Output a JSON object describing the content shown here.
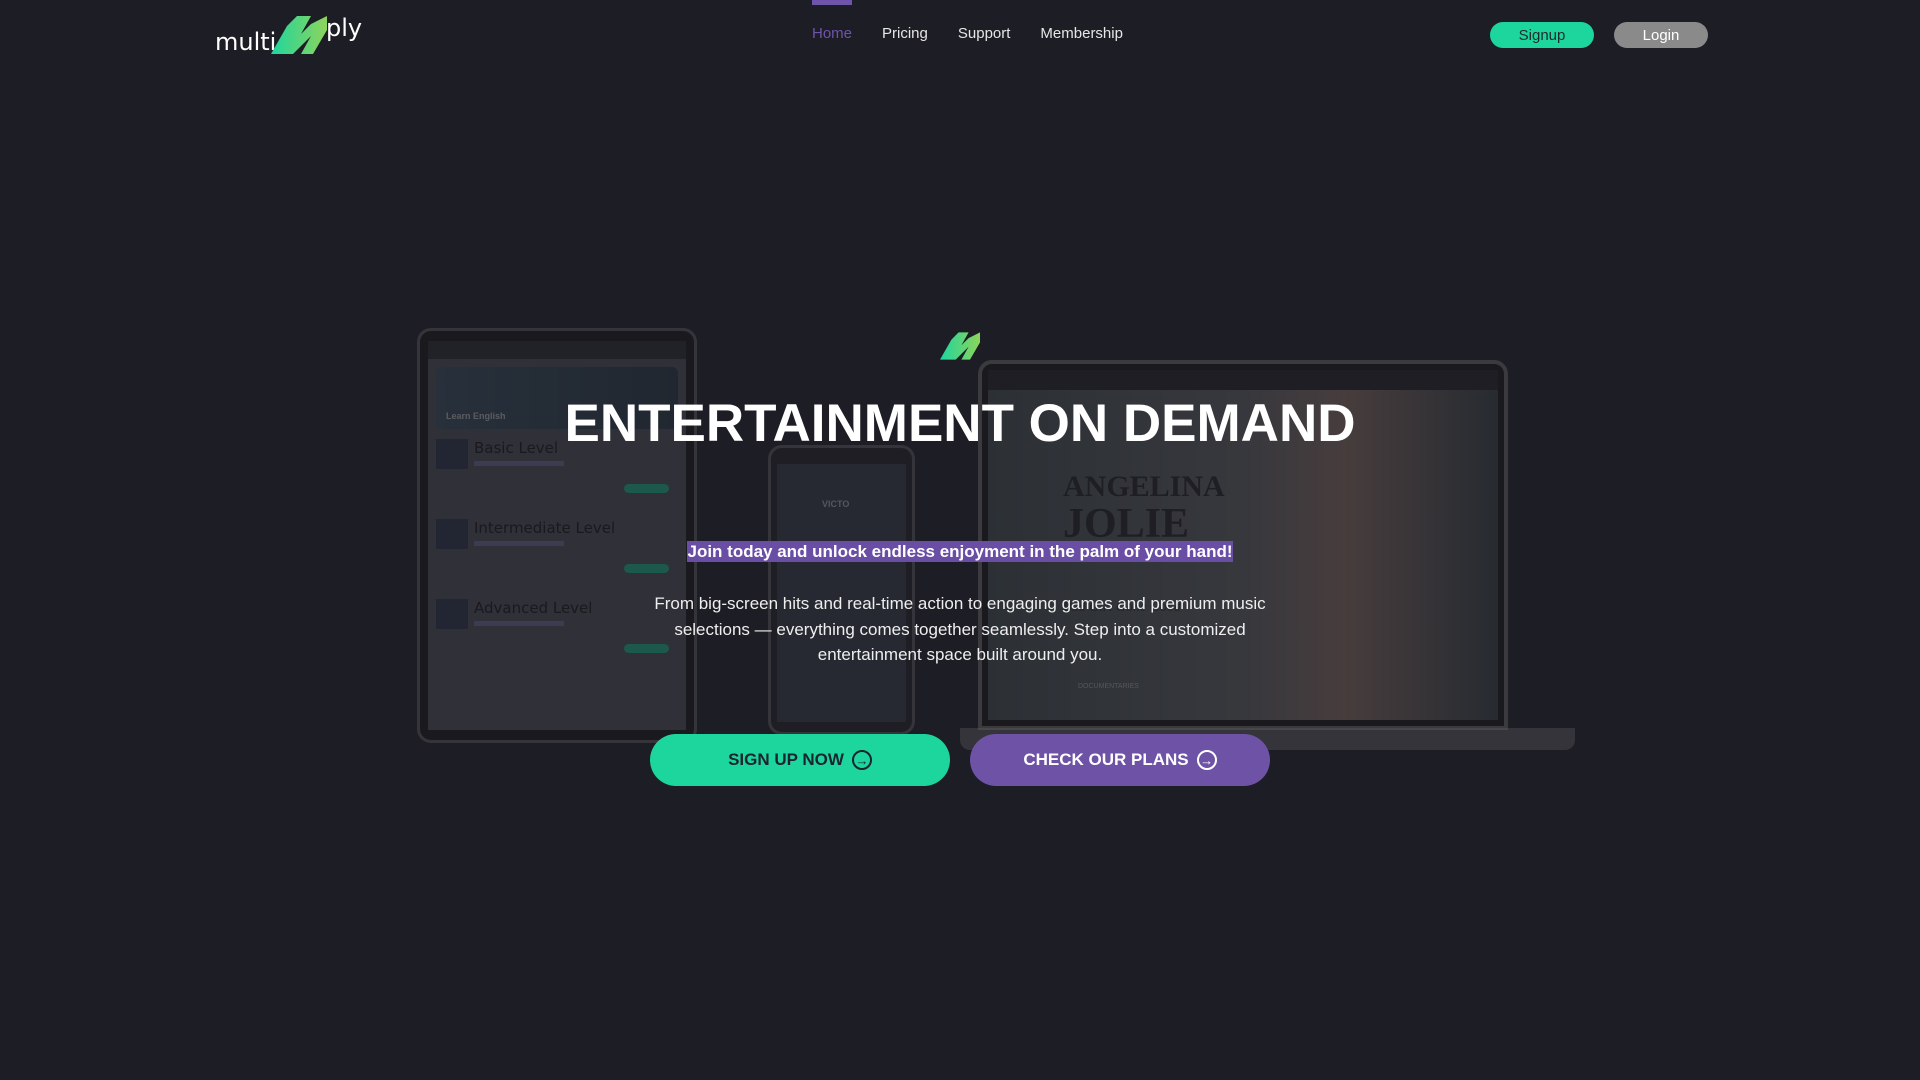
{
  "brand": {
    "logo_left": "multi",
    "logo_right": "ply",
    "colors": {
      "green": "#1dd69e",
      "purple": "#6d52a6",
      "bg": "#1d1d25"
    }
  },
  "nav": {
    "items": [
      {
        "label": "Home",
        "active": true
      },
      {
        "label": "Pricing"
      },
      {
        "label": "Support"
      },
      {
        "label": "Membership"
      }
    ]
  },
  "auth": {
    "signup": "Signup",
    "login": "Login"
  },
  "hero": {
    "title": "ENTERTAINMENT ON DEMAND",
    "tagline": "Join today and unlock endless enjoyment in the palm of your hand!",
    "description": "From big-screen hits and real-time action to engaging games and premium music selections — everything comes together seamlessly. Step into a customized entertainment space built around you.",
    "primary_cta": "SIGN UP NOW",
    "secondary_cta": "CHECK OUR PLANS",
    "cta_icon": "arrow-circle-right-icon"
  },
  "mockups": {
    "tablet": {
      "banner": "Learn English",
      "levels": [
        "Basic Level",
        "Intermediate Level",
        "Advanced Level"
      ]
    },
    "phone": {
      "banner": "VICTO"
    },
    "laptop": {
      "name1": "ANGELINA",
      "name2": "JOLIE",
      "subtitle": "Bad Girl Gone Good",
      "section": "DOCUMENTARIES"
    }
  }
}
